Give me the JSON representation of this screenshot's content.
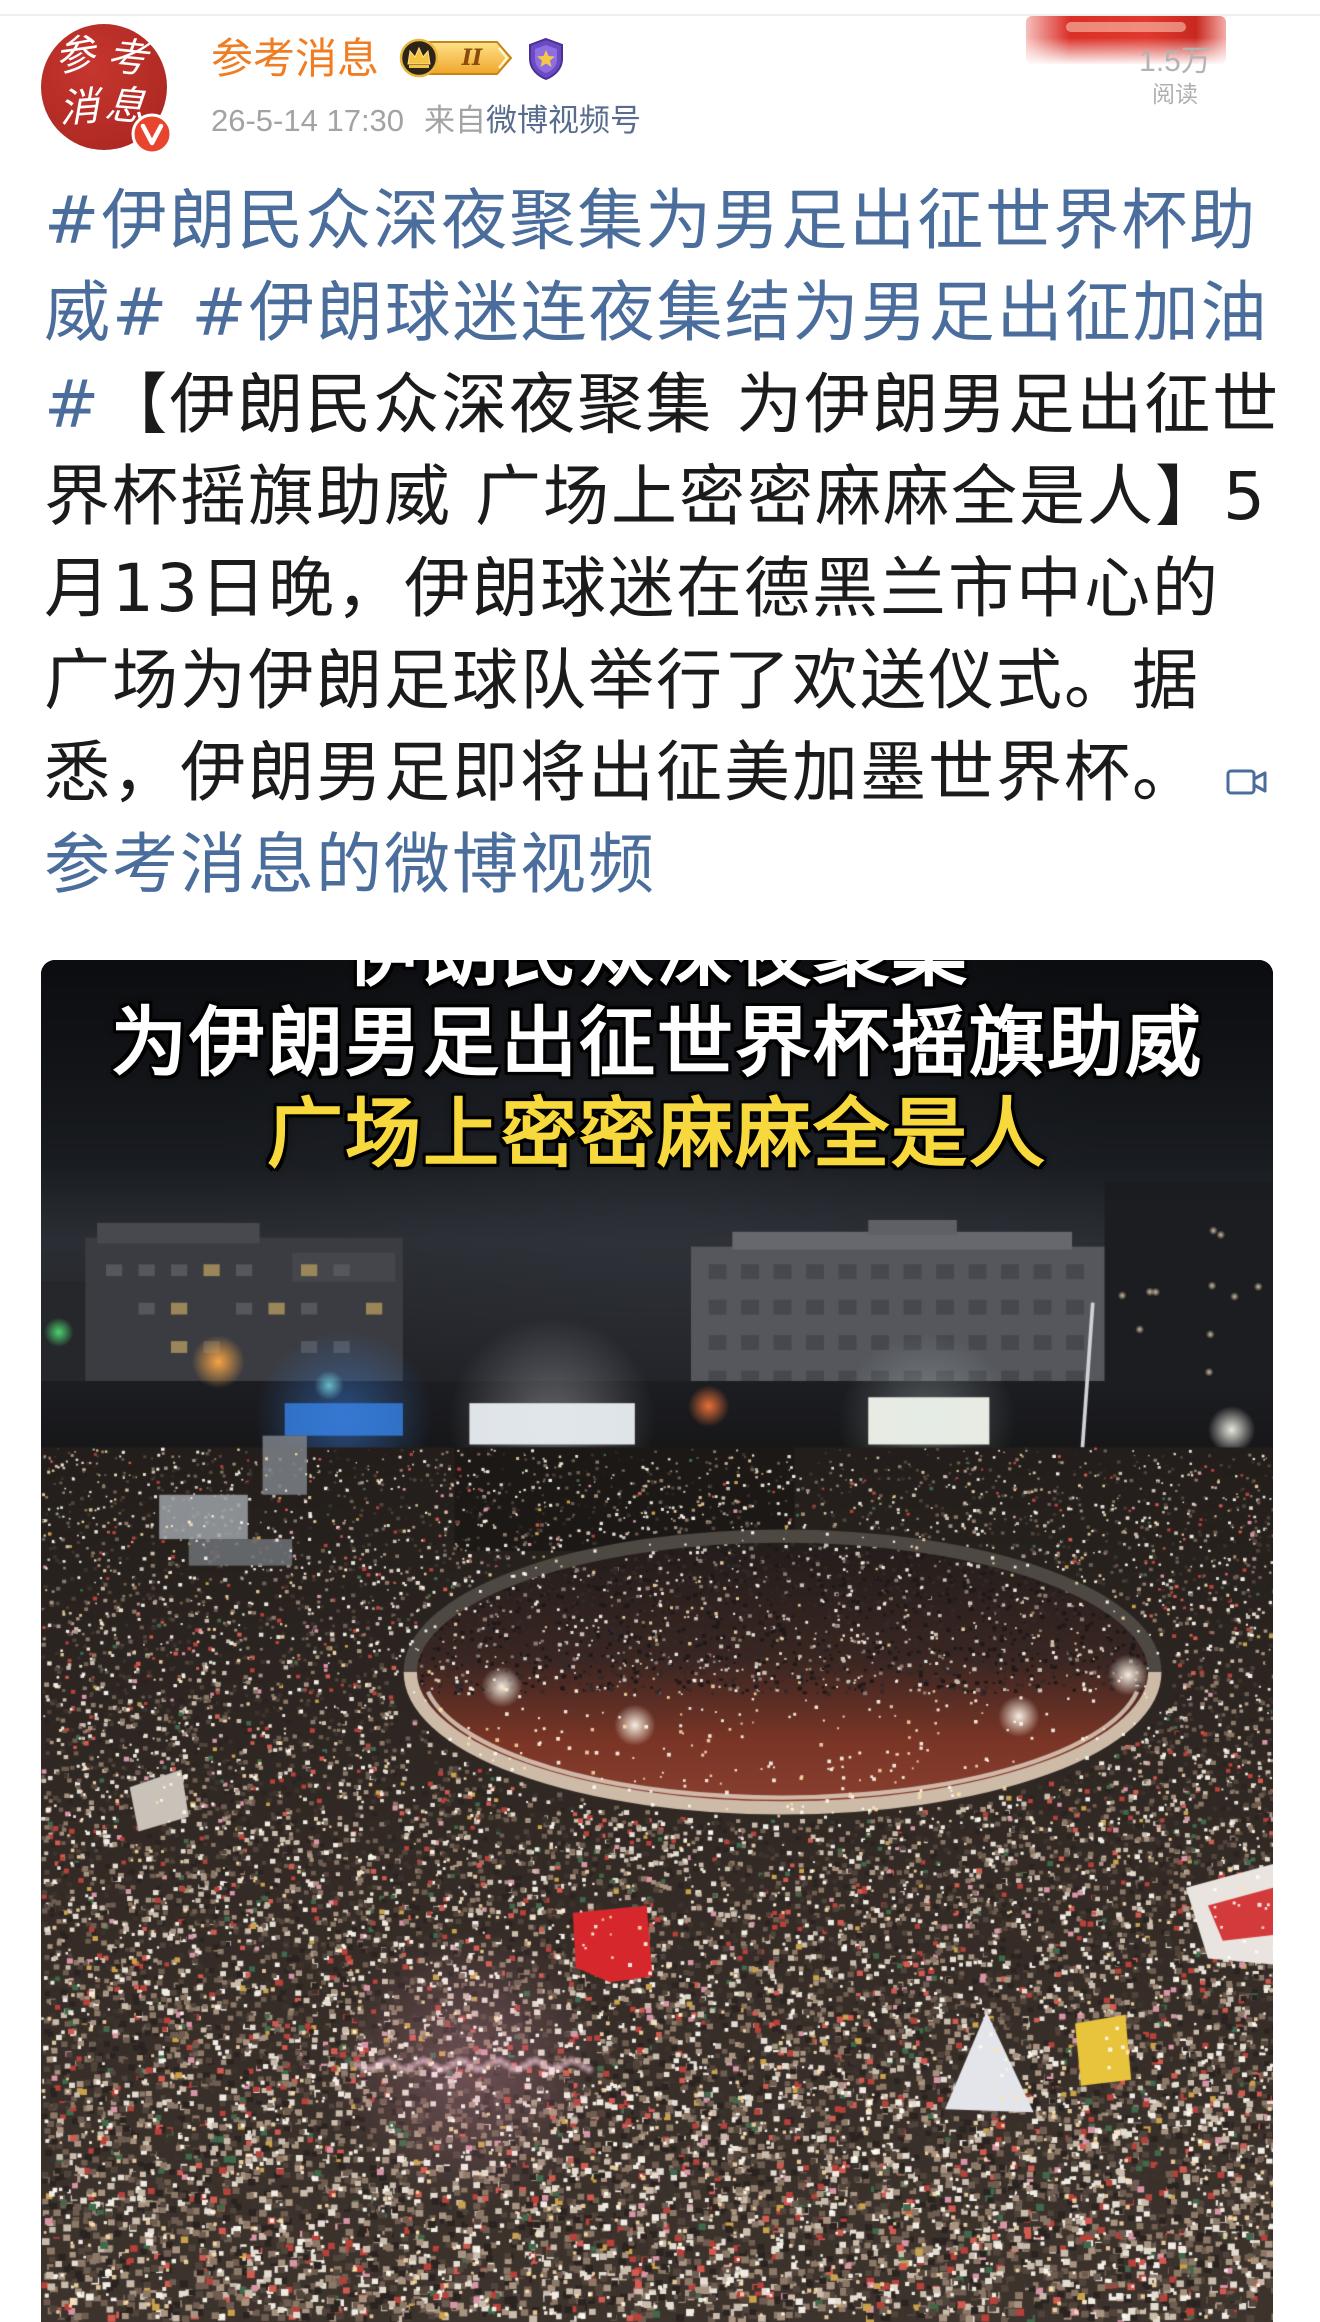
{
  "header": {
    "avatar_logo_chars": [
      "参",
      "考",
      "消",
      "息"
    ],
    "username": "参考消息",
    "level_badge_text": "II",
    "timestamp": "26-5-14 17:30",
    "source_prefix": "来自",
    "source_name": "微博视频号",
    "read_count": "1.5万",
    "read_label": "阅读"
  },
  "post": {
    "lines": [
      [
        "#伊朗民众深夜聚集为男足出征世界杯助"
      ],
      [
        "威#",
        "#伊朗球迷连夜集结为男足出征加油"
      ],
      [
        "#",
        "【伊朗民众深夜聚集 为伊朗男足出征世"
      ],
      [
        "界杯摇旗助威 广场上密密麻麻全是人】5"
      ],
      [
        "月13日晚，伊朗球迷在德黑兰市中心的"
      ],
      [
        "广场为伊朗足球队举行了欢送仪式。据"
      ],
      [
        "悉，伊朗男足即将出征美加墨世界杯。"
      ],
      [
        "参考消息的微博视频"
      ]
    ]
  },
  "video": {
    "caption_lines": [
      "伊朗民众深夜聚集",
      "为伊朗男足出征世界杯摇旗助威",
      "广场上密密麻麻全是人"
    ]
  },
  "colors": {
    "link": "#4a6d9c",
    "username": "#f07d22",
    "body_text": "#1b1b1b",
    "meta_text": "#a3a3a3",
    "source_link": "#586c8d",
    "caption_primary": "#ffffff",
    "caption_highlight": "#f7d93e",
    "avatar_bg": "#b02a24",
    "verified_badge": "#e8452f"
  },
  "icons": {
    "verified": "verified-icon",
    "level": "crown-icon",
    "shield": "shield-icon",
    "video_link": "video-camera-icon"
  }
}
